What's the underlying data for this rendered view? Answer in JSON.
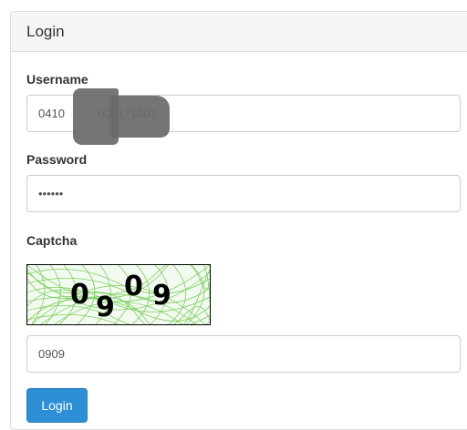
{
  "panel": {
    "title": "Login"
  },
  "form": {
    "username_label": "Username",
    "username_value": "0410          006171001",
    "password_label": "Password",
    "password_value": "••••••",
    "captcha_label": "Captcha",
    "captcha_image_chars": [
      "0",
      "9",
      "0",
      "9"
    ],
    "captcha_value": "0909",
    "login_button": "Login"
  },
  "colors": {
    "button_bg": "#2d8fd6",
    "captcha_lines": "#7ccf5e"
  }
}
